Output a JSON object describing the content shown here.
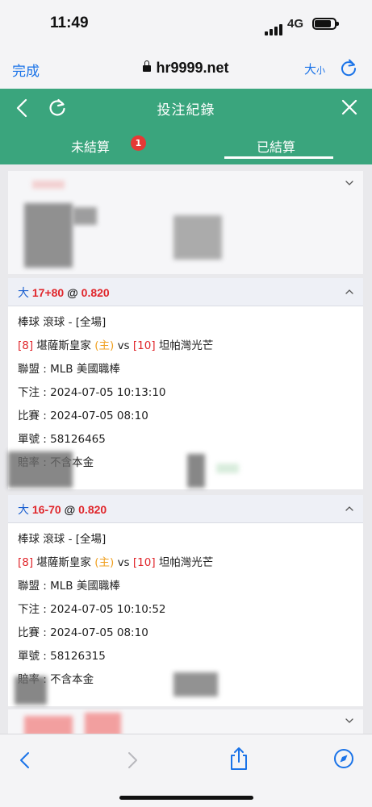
{
  "status_bar": {
    "time": "11:49",
    "network": "4G"
  },
  "browser": {
    "done_label": "完成",
    "url": "hr9999.net",
    "text_size_big": "大",
    "text_size_small": "小"
  },
  "app_header": {
    "title": "投注紀錄"
  },
  "tabs": {
    "unsettled": {
      "label": "未結算",
      "badge": "1"
    },
    "settled": {
      "label": "已結算"
    }
  },
  "cards": [
    {
      "bet": {
        "over": "大",
        "line": "17+80",
        "at": "@",
        "odds": "0.820"
      },
      "sport": "棒球 滾球 - [全場]",
      "home_seed": "[8]",
      "home_team": "堪薩斯皇家",
      "home_mark": "(主)",
      "vs": "vs",
      "away_seed": "[10]",
      "away_team": "坦帕灣光芒",
      "league": "聯盟 : MLB 美國職棒",
      "placed": "下注 : 2024-07-05 10:13:10",
      "match": "比賽 : 2024-07-05 08:10",
      "ticket": "單號 : 58126465",
      "odds_type": "賠率 : 不含本金"
    },
    {
      "bet": {
        "over": "大",
        "line": "16-70",
        "at": "@",
        "odds": "0.820"
      },
      "sport": "棒球 滾球 - [全場]",
      "home_seed": "[8]",
      "home_team": "堪薩斯皇家",
      "home_mark": "(主)",
      "vs": "vs",
      "away_seed": "[10]",
      "away_team": "坦帕灣光芒",
      "league": "聯盟 : MLB 美國職棒",
      "placed": "下注 : 2024-07-05 10:10:52",
      "match": "比賽 : 2024-07-05 08:10",
      "ticket": "單號 : 58126315",
      "odds_type": "賠率 : 不含本金"
    }
  ],
  "colors": {
    "header_green": "#3aa57d",
    "accent_blue": "#1a73e8",
    "bet_red": "#e0262b",
    "home_orange": "#f0a020",
    "badge_red": "#e53935"
  }
}
